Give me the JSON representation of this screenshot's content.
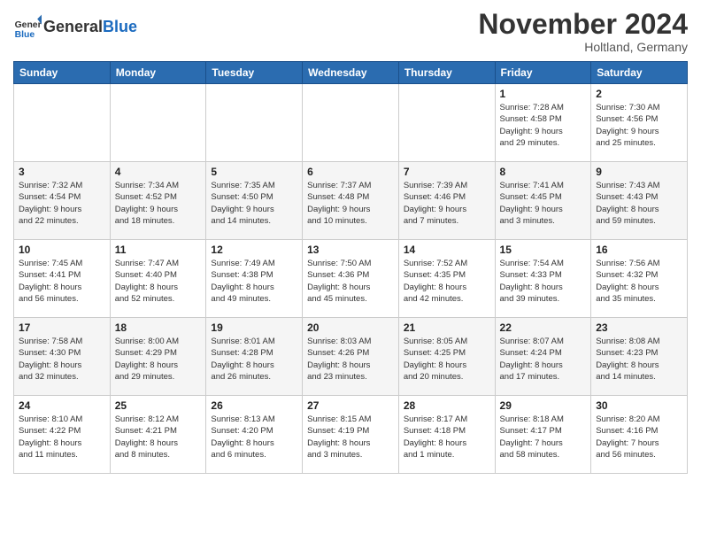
{
  "header": {
    "title": "November 2024",
    "location": "Holtland, Germany",
    "logo_general": "General",
    "logo_blue": "Blue"
  },
  "weekdays": [
    "Sunday",
    "Monday",
    "Tuesday",
    "Wednesday",
    "Thursday",
    "Friday",
    "Saturday"
  ],
  "weeks": [
    [
      {
        "day": "",
        "info": ""
      },
      {
        "day": "",
        "info": ""
      },
      {
        "day": "",
        "info": ""
      },
      {
        "day": "",
        "info": ""
      },
      {
        "day": "",
        "info": ""
      },
      {
        "day": "1",
        "info": "Sunrise: 7:28 AM\nSunset: 4:58 PM\nDaylight: 9 hours\nand 29 minutes."
      },
      {
        "day": "2",
        "info": "Sunrise: 7:30 AM\nSunset: 4:56 PM\nDaylight: 9 hours\nand 25 minutes."
      }
    ],
    [
      {
        "day": "3",
        "info": "Sunrise: 7:32 AM\nSunset: 4:54 PM\nDaylight: 9 hours\nand 22 minutes."
      },
      {
        "day": "4",
        "info": "Sunrise: 7:34 AM\nSunset: 4:52 PM\nDaylight: 9 hours\nand 18 minutes."
      },
      {
        "day": "5",
        "info": "Sunrise: 7:35 AM\nSunset: 4:50 PM\nDaylight: 9 hours\nand 14 minutes."
      },
      {
        "day": "6",
        "info": "Sunrise: 7:37 AM\nSunset: 4:48 PM\nDaylight: 9 hours\nand 10 minutes."
      },
      {
        "day": "7",
        "info": "Sunrise: 7:39 AM\nSunset: 4:46 PM\nDaylight: 9 hours\nand 7 minutes."
      },
      {
        "day": "8",
        "info": "Sunrise: 7:41 AM\nSunset: 4:45 PM\nDaylight: 9 hours\nand 3 minutes."
      },
      {
        "day": "9",
        "info": "Sunrise: 7:43 AM\nSunset: 4:43 PM\nDaylight: 8 hours\nand 59 minutes."
      }
    ],
    [
      {
        "day": "10",
        "info": "Sunrise: 7:45 AM\nSunset: 4:41 PM\nDaylight: 8 hours\nand 56 minutes."
      },
      {
        "day": "11",
        "info": "Sunrise: 7:47 AM\nSunset: 4:40 PM\nDaylight: 8 hours\nand 52 minutes."
      },
      {
        "day": "12",
        "info": "Sunrise: 7:49 AM\nSunset: 4:38 PM\nDaylight: 8 hours\nand 49 minutes."
      },
      {
        "day": "13",
        "info": "Sunrise: 7:50 AM\nSunset: 4:36 PM\nDaylight: 8 hours\nand 45 minutes."
      },
      {
        "day": "14",
        "info": "Sunrise: 7:52 AM\nSunset: 4:35 PM\nDaylight: 8 hours\nand 42 minutes."
      },
      {
        "day": "15",
        "info": "Sunrise: 7:54 AM\nSunset: 4:33 PM\nDaylight: 8 hours\nand 39 minutes."
      },
      {
        "day": "16",
        "info": "Sunrise: 7:56 AM\nSunset: 4:32 PM\nDaylight: 8 hours\nand 35 minutes."
      }
    ],
    [
      {
        "day": "17",
        "info": "Sunrise: 7:58 AM\nSunset: 4:30 PM\nDaylight: 8 hours\nand 32 minutes."
      },
      {
        "day": "18",
        "info": "Sunrise: 8:00 AM\nSunset: 4:29 PM\nDaylight: 8 hours\nand 29 minutes."
      },
      {
        "day": "19",
        "info": "Sunrise: 8:01 AM\nSunset: 4:28 PM\nDaylight: 8 hours\nand 26 minutes."
      },
      {
        "day": "20",
        "info": "Sunrise: 8:03 AM\nSunset: 4:26 PM\nDaylight: 8 hours\nand 23 minutes."
      },
      {
        "day": "21",
        "info": "Sunrise: 8:05 AM\nSunset: 4:25 PM\nDaylight: 8 hours\nand 20 minutes."
      },
      {
        "day": "22",
        "info": "Sunrise: 8:07 AM\nSunset: 4:24 PM\nDaylight: 8 hours\nand 17 minutes."
      },
      {
        "day": "23",
        "info": "Sunrise: 8:08 AM\nSunset: 4:23 PM\nDaylight: 8 hours\nand 14 minutes."
      }
    ],
    [
      {
        "day": "24",
        "info": "Sunrise: 8:10 AM\nSunset: 4:22 PM\nDaylight: 8 hours\nand 11 minutes."
      },
      {
        "day": "25",
        "info": "Sunrise: 8:12 AM\nSunset: 4:21 PM\nDaylight: 8 hours\nand 8 minutes."
      },
      {
        "day": "26",
        "info": "Sunrise: 8:13 AM\nSunset: 4:20 PM\nDaylight: 8 hours\nand 6 minutes."
      },
      {
        "day": "27",
        "info": "Sunrise: 8:15 AM\nSunset: 4:19 PM\nDaylight: 8 hours\nand 3 minutes."
      },
      {
        "day": "28",
        "info": "Sunrise: 8:17 AM\nSunset: 4:18 PM\nDaylight: 8 hours\nand 1 minute."
      },
      {
        "day": "29",
        "info": "Sunrise: 8:18 AM\nSunset: 4:17 PM\nDaylight: 7 hours\nand 58 minutes."
      },
      {
        "day": "30",
        "info": "Sunrise: 8:20 AM\nSunset: 4:16 PM\nDaylight: 7 hours\nand 56 minutes."
      }
    ]
  ]
}
